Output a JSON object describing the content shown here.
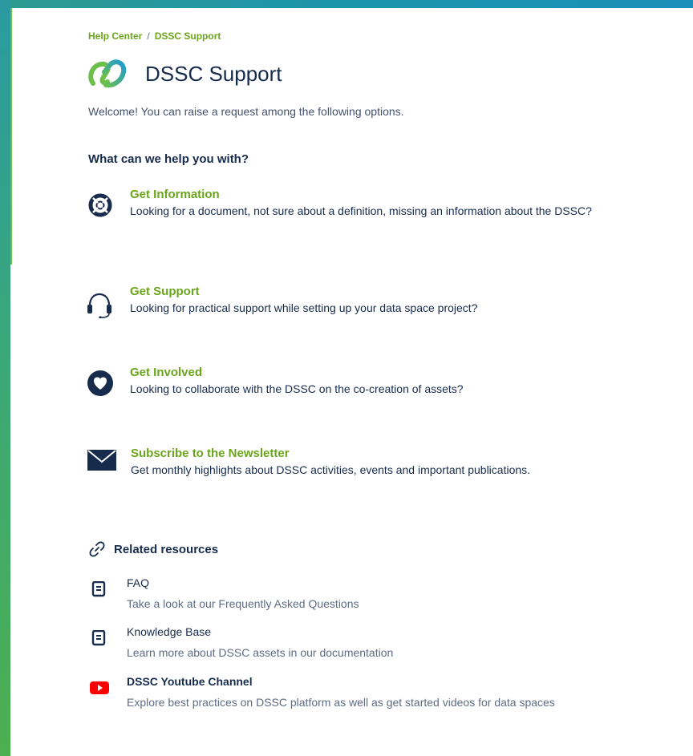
{
  "breadcrumb": {
    "home": "Help Center",
    "separator": "/",
    "current": "DSSC Support"
  },
  "header": {
    "title": "DSSC Support"
  },
  "welcome_text": "Welcome! You can raise a request among the following options.",
  "help_heading": "What can we help you with?",
  "options": [
    {
      "title": "Get Information",
      "description": "Looking for a document, not sure about a definition, missing an information about the DSSC?",
      "icon": "lifebuoy-icon"
    },
    {
      "title": "Get Support",
      "description": "Looking for practical support while setting up your data space project?",
      "icon": "headset-icon"
    },
    {
      "title": "Get Involved",
      "description": "Looking to collaborate with the DSSC on the co-creation of assets?",
      "icon": "heart-icon"
    },
    {
      "title": "Subscribe to the Newsletter",
      "description": "Get monthly highlights about DSSC activities, events and important publications.",
      "icon": "envelope-icon"
    }
  ],
  "related": {
    "heading": "Related resources",
    "items": [
      {
        "title": "FAQ",
        "description": "Take a look at our Frequently Asked Questions",
        "icon": "document-icon"
      },
      {
        "title": "Knowledge Base",
        "description": "Learn more about DSSC assets in our documentation",
        "icon": "document-icon"
      },
      {
        "title": "DSSC Youtube Channel",
        "description": "Explore best practices on DSSC platform as well as get started videos for data spaces",
        "icon": "youtube-icon"
      }
    ]
  },
  "colors": {
    "accent_green": "#6aa51c",
    "text_dark": "#172b4d",
    "text_muted": "#5e6c84",
    "youtube_red": "#ff0000"
  }
}
